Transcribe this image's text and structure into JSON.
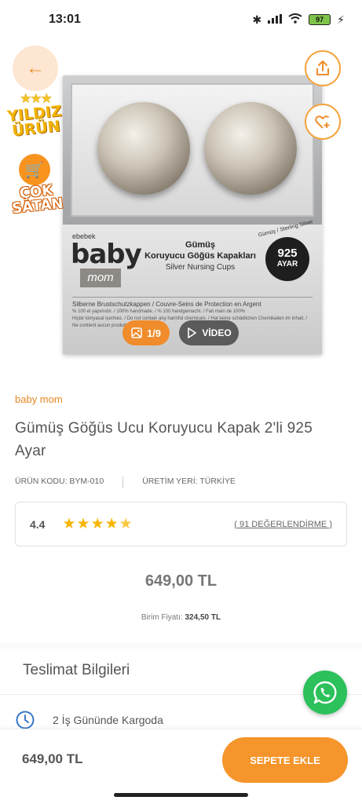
{
  "status_bar": {
    "time": "13:01",
    "battery": "97"
  },
  "hero": {
    "box": {
      "brand_small": "ebebek",
      "brand_main": "baby",
      "brand_sub": "mom",
      "title_line1": "Gümüş",
      "title_line2": "Koruyucu Göğüs Kapakları",
      "title_line3": "Silver Nursing Cups",
      "seal_caption": "Gümüş / Sterling Silver",
      "seal_number": "925",
      "seal_text": "AYAR",
      "line1": "Silberne Brustschutzkappen / Couvre-Seins de Protection en Argent",
      "line2": "% 100 el yapımıdır. / 100% handmade. / % 100 handgemacht. / Fait main de 100%",
      "line3": "Hiçbir kimyasal içermez. / Do not contain any harmful chemicals. / Hat keine schädlichen Chemikalien im Inhalt. /",
      "line4": "Ne contient aucun produit chimique."
    },
    "badges": {
      "star_text": "YILDIZ ÜRÜN",
      "sale_text": "ÇOK SATAN"
    },
    "pager": "1/9",
    "video_label": "VİDEO"
  },
  "product": {
    "brand": "baby mom",
    "title": "Gümüş Göğüs Ucu Koruyucu Kapak 2'li 925 Ayar",
    "code": "ÜRÜN KODU: BYM-010",
    "origin": "ÜRETİM YERİ: TÜRKİYE",
    "rating": "4.4",
    "rating_stars": 4.4,
    "rating_count": "( 91 DEĞERLENDİRME )",
    "price": "649,00 TL",
    "unit_price_label": "Birim Fiyatı:",
    "unit_price_value": "324,50 TL"
  },
  "delivery": {
    "title": "Teslimat Bilgileri",
    "line": "2 İş Gününde Kargoda"
  },
  "bottom_bar": {
    "price": "649,00 TL",
    "add_to_cart": "SEPETE EKLE"
  },
  "colors": {
    "accent": "#f5952b",
    "whatsapp": "#2cc15b",
    "star": "#f7b500"
  },
  "icons": [
    "back-arrow-icon",
    "share-icon",
    "heart-plus-icon",
    "image-icon",
    "play-icon",
    "clock-icon",
    "whatsapp-icon",
    "cart-icon",
    "star-icon"
  ]
}
